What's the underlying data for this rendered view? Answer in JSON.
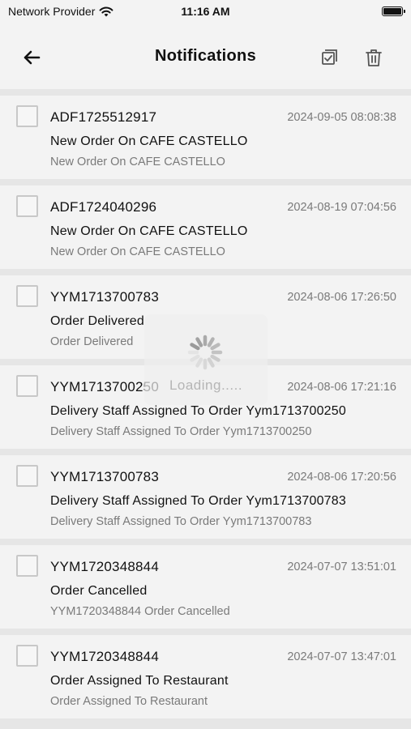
{
  "status_bar": {
    "carrier": "Network Provider",
    "time": "11:16 AM",
    "wifi_icon": "wifi-icon",
    "battery_icon": "battery-icon"
  },
  "header": {
    "title": "Notifications",
    "back_icon": "arrow-left-icon",
    "select_all_icon": "checkbox-multiple-icon",
    "delete_icon": "trash-icon"
  },
  "notifications": [
    {
      "order_id": "ADF1725512917",
      "timestamp": "2024-09-05 08:08:38",
      "title": "New Order On CAFE CASTELLO",
      "message": "New Order On CAFE CASTELLO"
    },
    {
      "order_id": "ADF1724040296",
      "timestamp": "2024-08-19 07:04:56",
      "title": "New Order On CAFE CASTELLO",
      "message": "New Order On CAFE CASTELLO"
    },
    {
      "order_id": "YYM1713700783",
      "timestamp": "2024-08-06 17:26:50",
      "title": "Order Delivered",
      "message": "Order Delivered"
    },
    {
      "order_id": "YYM1713700250",
      "timestamp": "2024-08-06 17:21:16",
      "title": "Delivery Staff Assigned To Order Yym1713700250",
      "message": "Delivery Staff Assigned To Order Yym1713700250"
    },
    {
      "order_id": "YYM1713700783",
      "timestamp": "2024-08-06 17:20:56",
      "title": "Delivery Staff Assigned To Order Yym1713700783",
      "message": "Delivery Staff Assigned To Order Yym1713700783"
    },
    {
      "order_id": "YYM1720348844",
      "timestamp": "2024-07-07 13:51:01",
      "title": "Order Cancelled",
      "message": "YYM1720348844 Order Cancelled"
    },
    {
      "order_id": "YYM1720348844",
      "timestamp": "2024-07-07 13:47:01",
      "title": "Order Assigned To Restaurant",
      "message": "Order Assigned To Restaurant"
    }
  ],
  "loading": {
    "text": "Loading.....",
    "icon": "spinner-icon"
  },
  "colors": {
    "background": "#e6e6e6",
    "card": "#f3f3f3",
    "text": "#111111",
    "muted": "#7a7a7a"
  }
}
